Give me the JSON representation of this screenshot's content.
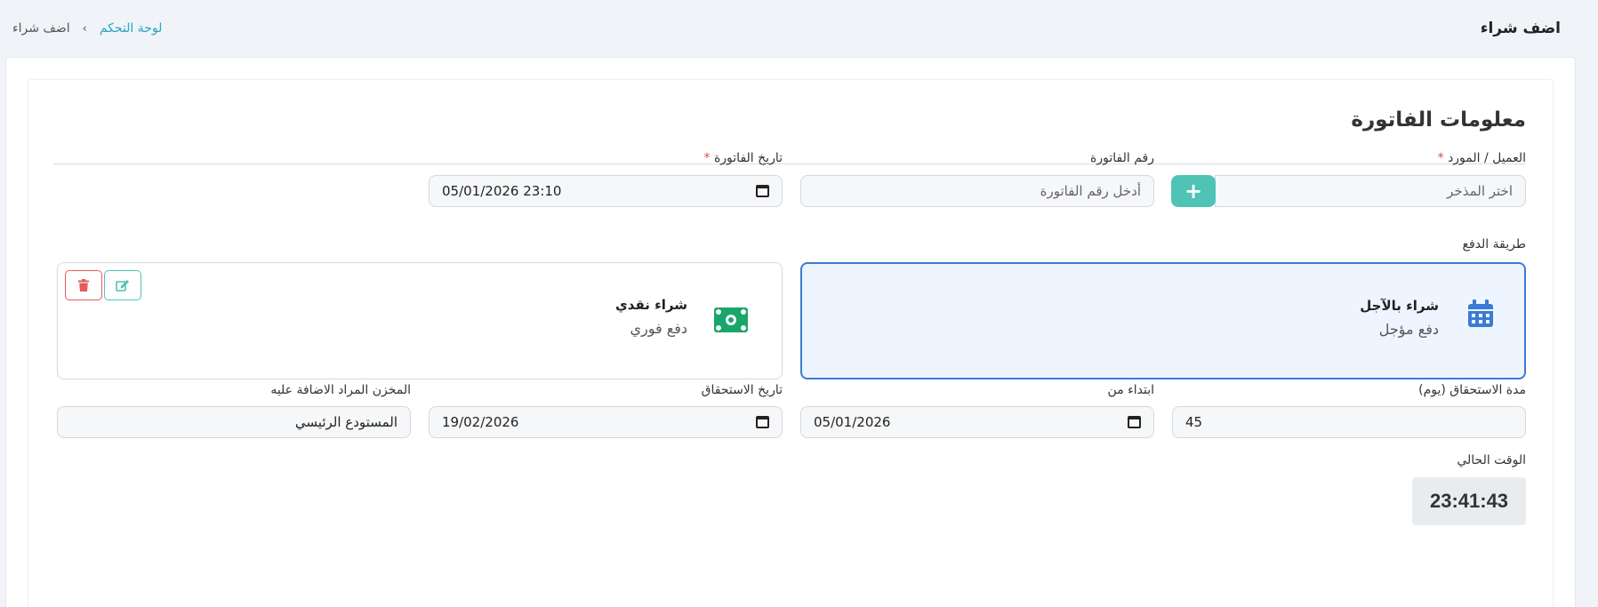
{
  "header": {
    "title": "اضف شراء",
    "breadcrumb": {
      "home": "لوحة التحكم",
      "separator": "›",
      "current": "اضف شراء"
    }
  },
  "invoice": {
    "section_title": "معلومات الفاتورة",
    "customer": {
      "label": "العميل / المورد",
      "required_mark": "*",
      "placeholder": "اختر المذخر",
      "add_label": "+"
    },
    "invoice_number": {
      "label": "رقم الفاتورة",
      "placeholder": "أدخل رقم الفاتورة"
    },
    "invoice_date": {
      "label": "تاريخ الفاتورة",
      "required_mark": "*",
      "value": "05/01/2026 23:10"
    },
    "payment": {
      "label": "طريقة الدفع",
      "credit": {
        "title": "شراء بالآجل",
        "subtitle": "دفع مؤجل",
        "icon": "calendar-icon",
        "selected": true
      },
      "cash": {
        "title": "شراء نقدي",
        "subtitle": "دفع فوري",
        "icon": "money-bill-icon",
        "selected": false
      }
    },
    "due_period": {
      "label": "مدة الاستحقاق (يوم)",
      "value": "45"
    },
    "start_from": {
      "label": "ابتداء من",
      "value": "05/01/2026"
    },
    "due_date": {
      "label": "تاريخ الاستحقاق",
      "value": "19/02/2026"
    },
    "warehouse": {
      "label": "المخزن المراد الاضافة عليه",
      "value": "المستودع الرئيسي"
    },
    "current_time": {
      "label": "الوقت الحالي",
      "value": "23:41:43"
    }
  },
  "colors": {
    "accent_teal": "#4fc3b6",
    "link": "#2aa5c0",
    "selected_border": "#3a7bd5",
    "selected_bg": "#eef5ff",
    "danger": "#e45b5b",
    "money_green": "#1aa56b"
  }
}
